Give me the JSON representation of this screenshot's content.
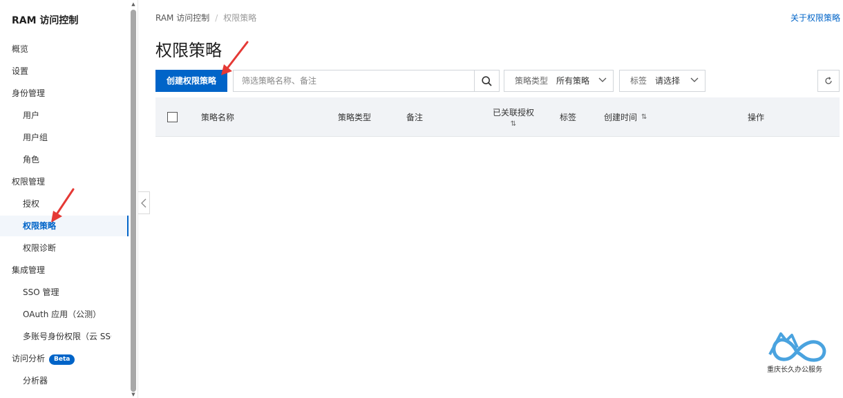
{
  "sidebar": {
    "title": "RAM 访问控制",
    "items": [
      {
        "label": "概览",
        "level": "top"
      },
      {
        "label": "设置",
        "level": "top"
      },
      {
        "label": "身份管理",
        "level": "top"
      },
      {
        "label": "用户",
        "level": "sub"
      },
      {
        "label": "用户组",
        "level": "sub"
      },
      {
        "label": "角色",
        "level": "sub"
      },
      {
        "label": "权限管理",
        "level": "top"
      },
      {
        "label": "授权",
        "level": "sub"
      },
      {
        "label": "权限策略",
        "level": "sub",
        "active": true
      },
      {
        "label": "权限诊断",
        "level": "sub"
      },
      {
        "label": "集成管理",
        "level": "top"
      },
      {
        "label": "SSO 管理",
        "level": "sub"
      },
      {
        "label": "OAuth 应用（公测）",
        "level": "sub"
      },
      {
        "label": "多账号身份权限（云 SSO）",
        "level": "sub"
      },
      {
        "label": "访问分析",
        "level": "top",
        "badge": "Beta"
      },
      {
        "label": "分析器",
        "level": "sub"
      }
    ]
  },
  "breadcrumb": {
    "root": "RAM 访问控制",
    "separator": "/",
    "current": "权限策略"
  },
  "help_link": "关于权限策略",
  "page_title": "权限策略",
  "toolbar": {
    "create_label": "创建权限策略",
    "search_placeholder": "筛选策略名称、备注",
    "policy_type_label": "策略类型",
    "policy_type_value": "所有策略",
    "tag_label": "标签",
    "tag_value": "请选择"
  },
  "table": {
    "columns": [
      "策略名称",
      "策略类型",
      "备注",
      "已关联授权",
      "标签",
      "创建时间",
      "操作"
    ]
  },
  "watermark": {
    "text": "重庆长久办公服务"
  },
  "colors": {
    "primary": "#0064c8",
    "annotation_arrow": "#e53935",
    "logo": "#4aa3df"
  }
}
